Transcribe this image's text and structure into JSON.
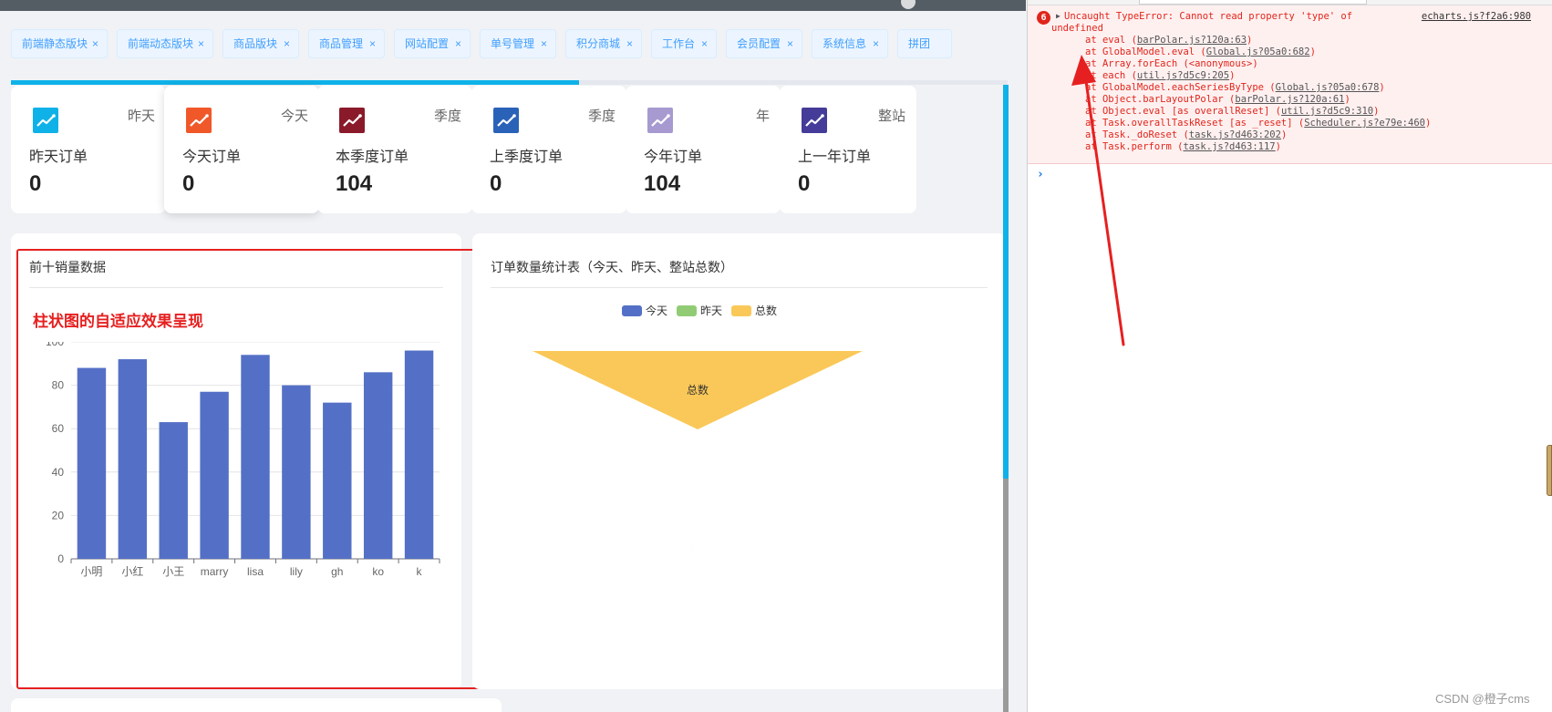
{
  "tags": [
    {
      "label": "前端静态版块"
    },
    {
      "label": "前端动态版块"
    },
    {
      "label": "商品版块"
    },
    {
      "label": "商品管理"
    },
    {
      "label": "网站配置"
    },
    {
      "label": "单号管理"
    },
    {
      "label": "积分商城"
    },
    {
      "label": "工作台"
    },
    {
      "label": "会员配置"
    },
    {
      "label": "系统信息"
    },
    {
      "label": "拼团"
    }
  ],
  "tag_close_symbol": "×",
  "page_progress": 0.57,
  "stats": [
    {
      "period": "昨天",
      "title": "昨天订单",
      "value": "0",
      "icon": "trend-chart-icon",
      "color": "#0fb2e8"
    },
    {
      "period": "今天",
      "title": "今天订单",
      "value": "0",
      "icon": "trend-chart-icon",
      "color": "#f0582a"
    },
    {
      "period": "季度",
      "title": "本季度订单",
      "value": "104",
      "icon": "trend-chart-icon",
      "color": "#8a1a2a"
    },
    {
      "period": "季度",
      "title": "上季度订单",
      "value": "0",
      "icon": "trend-chart-icon",
      "color": "#2a62b8"
    },
    {
      "period": "年",
      "title": "今年订单",
      "value": "104",
      "icon": "trend-chart-icon",
      "color": "#a79ad0"
    },
    {
      "period": "整站",
      "title": "上一年订单",
      "value": "0",
      "icon": "trend-chart-icon",
      "color": "#443c98"
    }
  ],
  "sales_panel": {
    "title": "前十销量数据",
    "annotation": "柱状图的自适应效果呈现"
  },
  "orders_panel": {
    "title": "订单数量统计表（今天、昨天、整站总数）"
  },
  "chart_data": [
    {
      "type": "bar",
      "categories": [
        "小明",
        "小红",
        "小王",
        "marry",
        "lisa",
        "lily",
        "gh",
        "ko",
        "k"
      ],
      "values": [
        88,
        92,
        63,
        77,
        94,
        80,
        72,
        86,
        96
      ],
      "ylim": [
        0,
        100
      ],
      "yticks": [
        0,
        20,
        40,
        60,
        80,
        100
      ],
      "color": "#5470c6",
      "grid": true
    },
    {
      "type": "funnel",
      "legend": [
        {
          "name": "今天",
          "color": "#5470c6"
        },
        {
          "name": "昨天",
          "color": "#91cc75"
        },
        {
          "name": "总数",
          "color": "#fac858"
        }
      ],
      "legend_position": "top",
      "segments": [
        {
          "name": "总数",
          "value": 104,
          "color": "#fac858"
        },
        {
          "name": "今天",
          "value": 0,
          "color": "#5470c6"
        },
        {
          "name": "昨天",
          "value": 0,
          "color": "#91cc75"
        }
      ]
    }
  ],
  "console": {
    "error_count": "6",
    "message_line1": "Uncaught TypeError: Cannot read property 'type' of",
    "message_line2": "undefined",
    "source": "echarts.js?f2a6:980",
    "stack": [
      {
        "text": "at eval (",
        "link": "barPolar.js?120a:63",
        "tail": ")"
      },
      {
        "text": "at GlobalModel.eval (",
        "link": "Global.js?05a0:682",
        "tail": ")"
      },
      {
        "text": "at Array.forEach (<anonymous>)",
        "link": "",
        "tail": ""
      },
      {
        "text": "at each (",
        "link": "util.js?d5c9:205",
        "tail": ")"
      },
      {
        "text": "at GlobalModel.eachSeriesByType (",
        "link": "Global.js?05a0:678",
        "tail": ")"
      },
      {
        "text": "at Object.barLayoutPolar (",
        "link": "barPolar.js?120a:61",
        "tail": ")"
      },
      {
        "text": "at Object.eval [as overallReset] (",
        "link": "util.js?d5c9:310",
        "tail": ")"
      },
      {
        "text": "at Task.overallTaskReset [as _reset] (",
        "link": "Scheduler.js?e79e:460",
        "tail": ")"
      },
      {
        "text": "at Task._doReset (",
        "link": "task.js?d463:202",
        "tail": ")"
      },
      {
        "text": "at Task.perform (",
        "link": "task.js?d463:117",
        "tail": ")"
      }
    ],
    "prompt": "›"
  },
  "watermark": "CSDN @橙子cms",
  "annotation_color": "#e62020"
}
